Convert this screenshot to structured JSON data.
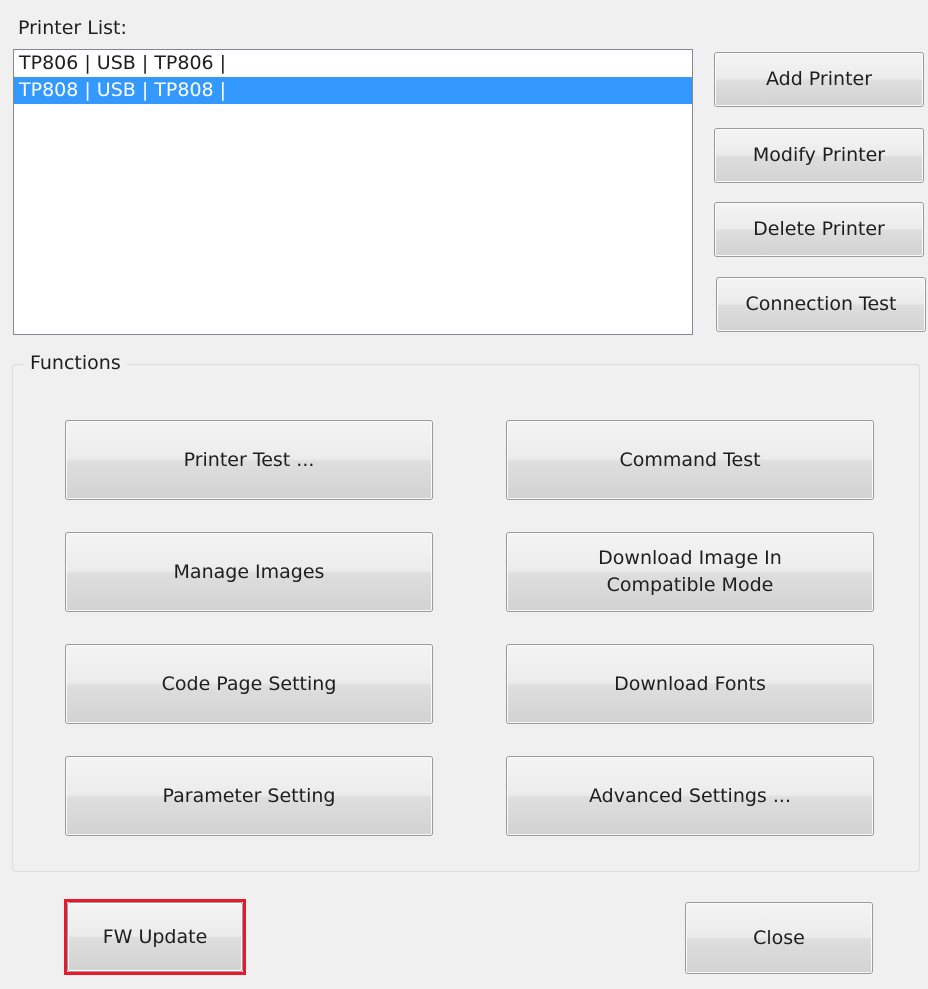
{
  "printer_list": {
    "label": "Printer List:",
    "items": [
      {
        "text": "TP806 | USB | TP806 |",
        "selected": false
      },
      {
        "text": "TP808 | USB | TP808 |",
        "selected": true
      }
    ]
  },
  "side_buttons": {
    "add_printer": "Add Printer",
    "modify_printer": "Modify Printer",
    "delete_printer": "Delete Printer",
    "connection_test": "Connection Test"
  },
  "functions": {
    "title": "Functions",
    "printer_test": "Printer Test ...",
    "command_test": "Command Test",
    "manage_images": "Manage Images",
    "download_image_line1": "Download Image In",
    "download_image_line2": "Compatible Mode",
    "code_page_setting": "Code Page Setting",
    "download_fonts": "Download Fonts",
    "parameter_setting": "Parameter Setting",
    "advanced_settings": "Advanced Settings ..."
  },
  "footer": {
    "fw_update": "FW Update",
    "close": "Close"
  },
  "colors": {
    "selection": "#3399ff",
    "highlight_border": "#e8192c",
    "window_background": "#f0f0f0"
  }
}
